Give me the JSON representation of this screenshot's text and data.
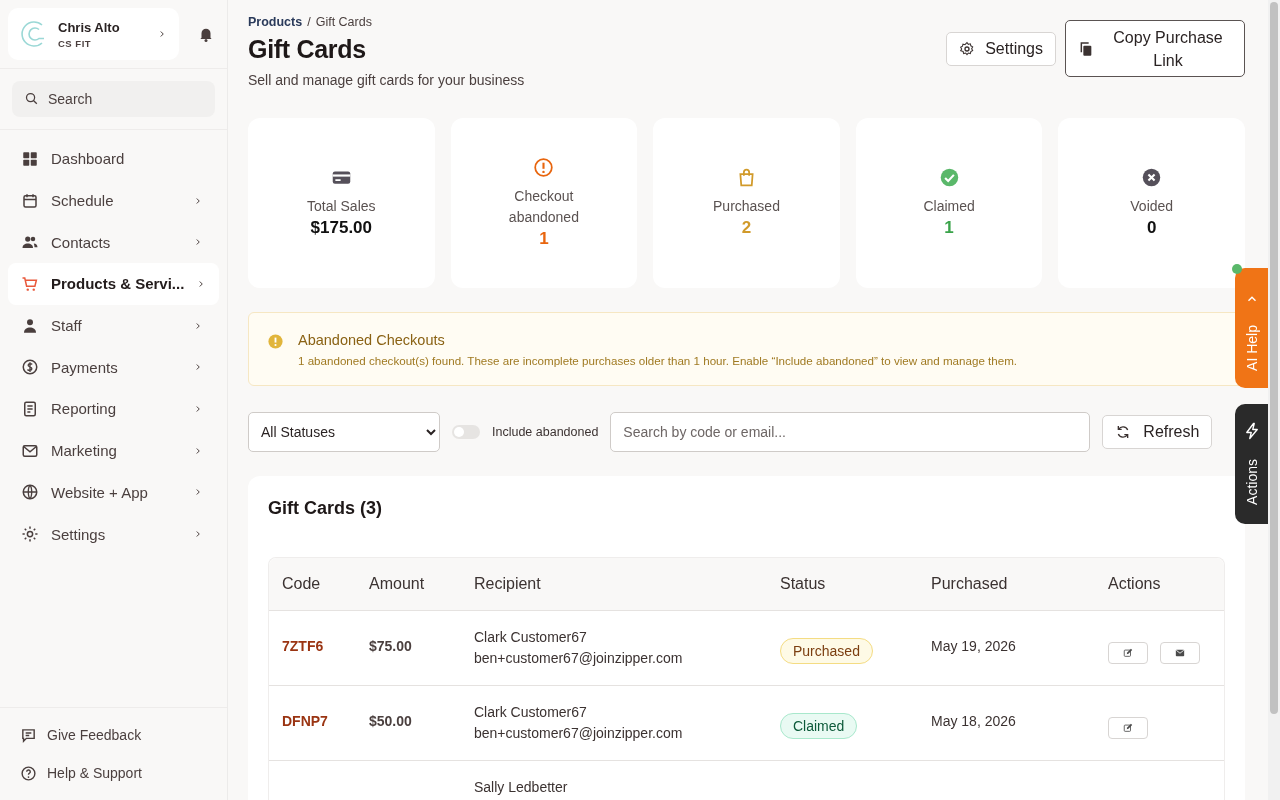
{
  "account": {
    "name": "Chris Alto",
    "org": "CS FIT"
  },
  "sidebar_search": {
    "placeholder": "Search"
  },
  "nav": [
    {
      "label": "Dashboard",
      "selected": false,
      "chevron": false
    },
    {
      "label": "Schedule",
      "selected": false,
      "chevron": true
    },
    {
      "label": "Contacts",
      "selected": false,
      "chevron": true
    },
    {
      "label": "Products & Servi...",
      "selected": true,
      "chevron": true
    },
    {
      "label": "Staff",
      "selected": false,
      "chevron": true
    },
    {
      "label": "Payments",
      "selected": false,
      "chevron": true
    },
    {
      "label": "Reporting",
      "selected": false,
      "chevron": true
    },
    {
      "label": "Marketing",
      "selected": false,
      "chevron": true
    },
    {
      "label": "Website + App",
      "selected": false,
      "chevron": true
    },
    {
      "label": "Settings",
      "selected": false,
      "chevron": true
    }
  ],
  "footer_links": [
    {
      "label": "Give Feedback"
    },
    {
      "label": "Help & Support"
    }
  ],
  "breadcrumb": {
    "parent": "Products",
    "separator": "/",
    "current": "Gift Cards"
  },
  "page": {
    "title": "Gift Cards",
    "subtitle": "Sell and manage gift cards for your business"
  },
  "header_buttons": [
    {
      "label": "Settings"
    },
    {
      "label": "Copy Purchase Link"
    }
  ],
  "stats": [
    {
      "label": "Total Sales",
      "value": "$175.00",
      "color": "#111111"
    },
    {
      "label": "Checkout abandoned",
      "value": "1",
      "color": "#e8650e"
    },
    {
      "label": "Purchased",
      "value": "2",
      "color": "#d19a2a"
    },
    {
      "label": "Claimed",
      "value": "1",
      "color": "#3aa34a"
    },
    {
      "label": "Voided",
      "value": "0",
      "color": "#111111"
    }
  ],
  "alert": {
    "title": "Abandoned Checkouts",
    "message": "1 abandoned checkout(s) found. These are incomplete purchases older than 1 hour. Enable “Include abandoned” to view and manage them."
  },
  "filters": {
    "status_select": "All Statuses",
    "include_abandoned": {
      "label": "Include abandoned",
      "on": false
    },
    "search": {
      "placeholder": "Search by code or email..."
    },
    "refresh": "Refresh"
  },
  "table": {
    "title": "Gift Cards (3)",
    "columns": [
      "Code",
      "Amount",
      "Recipient",
      "Status",
      "Purchased",
      "Actions"
    ],
    "rows": [
      {
        "code": "7ZTF6",
        "amount": "$75.00",
        "recipient_name": "Clark Customer67",
        "recipient_email": "ben+customer67@joinzipper.com",
        "status": {
          "label": "Purchased",
          "kind": "purchased"
        },
        "purchased": "May 19, 2026",
        "actions": [
          {
            "kind": "edit"
          },
          {
            "kind": "email"
          }
        ]
      },
      {
        "code": "DFNP7",
        "amount": "$50.00",
        "recipient_name": "Clark Customer67",
        "recipient_email": "ben+customer67@joinzipper.com",
        "status": {
          "label": "Claimed",
          "kind": "claimed"
        },
        "purchased": "May 18, 2026",
        "actions": [
          {
            "kind": "edit"
          }
        ]
      },
      {
        "recipient_name": "Sally Ledbetter"
      }
    ]
  },
  "side_tabs": [
    {
      "label": "AI Help",
      "online": true
    },
    {
      "label": "Actions",
      "online": false
    }
  ]
}
